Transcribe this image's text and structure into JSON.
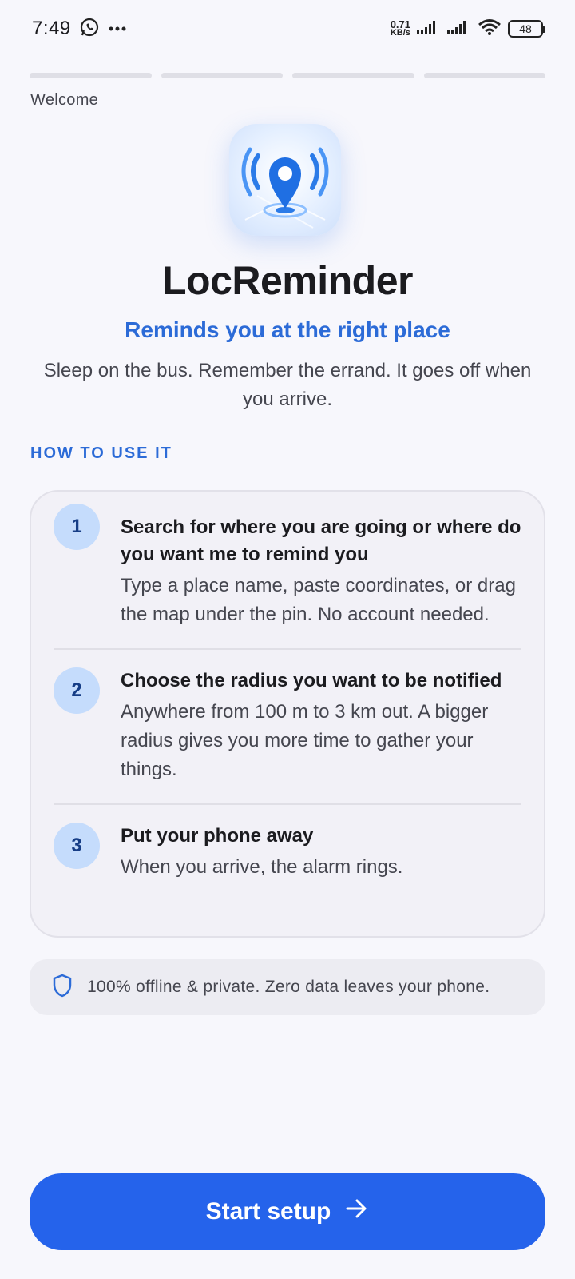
{
  "status_bar": {
    "time": "7:49",
    "net_speed_value": "0.71",
    "net_speed_unit": "KB/s",
    "battery": "48"
  },
  "onboarding": {
    "progress_total": 4,
    "step_label": "Welcome"
  },
  "app": {
    "name": "LocReminder",
    "tagline": "Reminds you at the right place",
    "description": "Sleep on the bus. Remember the errand. It goes off when you arrive."
  },
  "how_to": {
    "title": "HOW TO USE IT",
    "steps": [
      {
        "number": "1",
        "title": "Search for where you are going or where do you want me to remind you",
        "body": "Type a place name, paste coordinates, or drag the map under the pin. No account needed."
      },
      {
        "number": "2",
        "title": "Choose the radius you want to be notified",
        "body": "Anywhere from 100 m to 3 km out. A bigger radius gives you more time to gather your things."
      },
      {
        "number": "3",
        "title": "Put your phone away",
        "body": "When you arrive, the alarm rings."
      }
    ]
  },
  "privacy_note": "100% offline & private. Zero data leaves your phone.",
  "cta": {
    "label": "Start setup",
    "icon": "arrow-right-icon"
  },
  "colors": {
    "accent": "#2563eb",
    "accent_text": "#2c6bd7",
    "background": "#f7f7fc",
    "step_badge": "#c5dcfc"
  }
}
